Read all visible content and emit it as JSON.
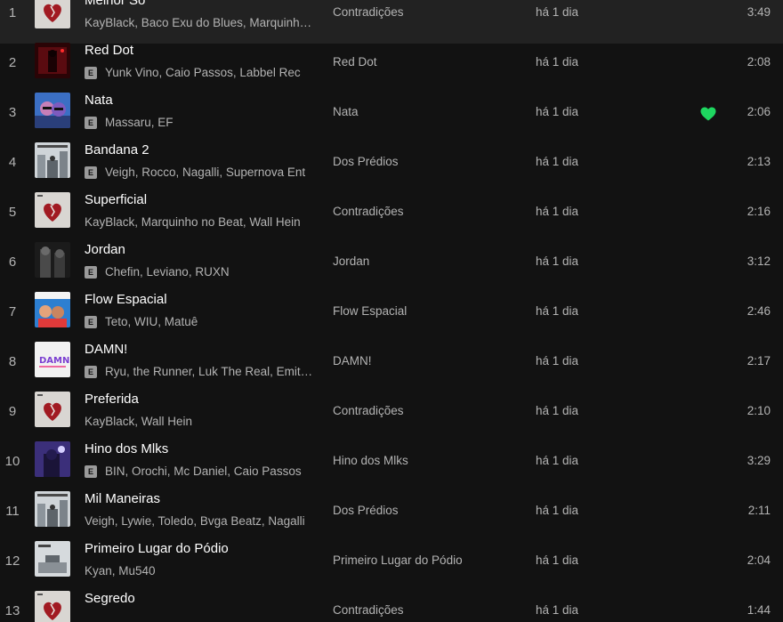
{
  "accent_color": "#1ed760",
  "tracks": [
    {
      "num": "1",
      "title": "Melhor Só",
      "explicit": false,
      "artists": "KayBlack, Baco Exu do Blues, Marquinho no Beat",
      "album": "Contradições",
      "added": "há 1 dia",
      "liked": false,
      "duration": "3:49",
      "cover_icon": "heart-album-cover"
    },
    {
      "num": "2",
      "title": "Red Dot",
      "explicit": true,
      "artists": "Yunk Vino, Caio Passos, Labbel Rec",
      "album": "Red Dot",
      "added": "há 1 dia",
      "liked": false,
      "duration": "2:08",
      "cover_icon": "red-dot-cover"
    },
    {
      "num": "3",
      "title": "Nata",
      "explicit": true,
      "artists": "Massaru, EF",
      "album": "Nata",
      "added": "há 1 dia",
      "liked": true,
      "duration": "2:06",
      "cover_icon": "nata-cover"
    },
    {
      "num": "4",
      "title": "Bandana 2",
      "explicit": true,
      "artists": "Veigh, Rocco, Nagalli, Supernova Ent",
      "album": "Dos Prédios",
      "added": "há 1 dia",
      "liked": false,
      "duration": "2:13",
      "cover_icon": "buildings-cover"
    },
    {
      "num": "5",
      "title": "Superficial",
      "explicit": false,
      "artists": "KayBlack, Marquinho no Beat, Wall Hein",
      "album": "Contradições",
      "added": "há 1 dia",
      "liked": false,
      "duration": "2:16",
      "cover_icon": "heart-album-cover"
    },
    {
      "num": "6",
      "title": "Jordan",
      "explicit": true,
      "artists": "Chefin, Leviano, RUXN",
      "album": "Jordan",
      "added": "há 1 dia",
      "liked": false,
      "duration": "3:12",
      "cover_icon": "jordan-cover"
    },
    {
      "num": "7",
      "title": "Flow Espacial",
      "explicit": true,
      "artists": "Teto, WIU, Matuê",
      "album": "Flow Espacial",
      "added": "há 1 dia",
      "liked": false,
      "duration": "2:46",
      "cover_icon": "flow-espacial-cover"
    },
    {
      "num": "8",
      "title": "DAMN!",
      "explicit": true,
      "artists": "Ryu, the Runner, Luk The Real, Emitê Único",
      "album": "DAMN!",
      "added": "há 1 dia",
      "liked": false,
      "duration": "2:17",
      "cover_icon": "damn-cover"
    },
    {
      "num": "9",
      "title": "Preferida",
      "explicit": false,
      "artists": "KayBlack, Wall Hein",
      "album": "Contradições",
      "added": "há 1 dia",
      "liked": false,
      "duration": "2:10",
      "cover_icon": "heart-album-cover"
    },
    {
      "num": "10",
      "title": "Hino dos Mlks",
      "explicit": true,
      "artists": "BIN, Orochi, Mc Daniel, Caio Passos",
      "album": "Hino dos Mlks",
      "added": "há 1 dia",
      "liked": false,
      "duration": "3:29",
      "cover_icon": "hino-cover"
    },
    {
      "num": "11",
      "title": "Mil Maneiras",
      "explicit": false,
      "artists": "Veigh, Lywie, Toledo, Bvga Beatz, Nagalli",
      "album": "Dos Prédios",
      "added": "há 1 dia",
      "liked": false,
      "duration": "2:11",
      "cover_icon": "buildings-cover"
    },
    {
      "num": "12",
      "title": "Primeiro Lugar do Pódio",
      "explicit": false,
      "artists": "Kyan, Mu540",
      "album": "Primeiro Lugar do Pódio",
      "added": "há 1 dia",
      "liked": false,
      "duration": "2:04",
      "cover_icon": "podio-cover"
    },
    {
      "num": "13",
      "title": "Segredo",
      "explicit": false,
      "artists": "",
      "album": "Contradições",
      "added": "há 1 dia",
      "liked": false,
      "duration": "1:44",
      "cover_icon": "heart-album-cover"
    }
  ]
}
